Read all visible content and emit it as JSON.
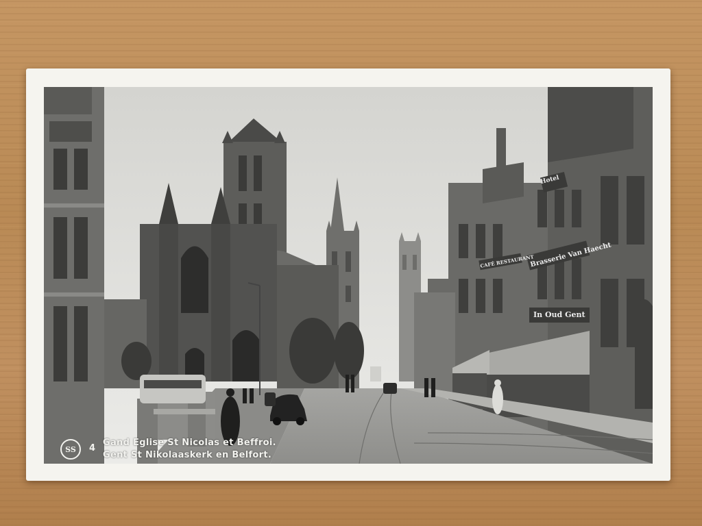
{
  "caption": {
    "number": "4",
    "line_fr": "Gand   Eglise St Nicolas et Beffroi.",
    "line_nl": "Gent   St Nikolaaskerk en Belfort."
  },
  "logo": {
    "text": "SS"
  },
  "signs": {
    "hotel": "Hotel",
    "van_haecht": "Brasserie Van Haecht",
    "oud_gent": "In Oud Gent",
    "cafe": "CAFÉ RESTAURANT"
  },
  "colors": {
    "wood": "#b98a55",
    "card": "#f5f4ef",
    "sky": "#d9d9d6"
  }
}
